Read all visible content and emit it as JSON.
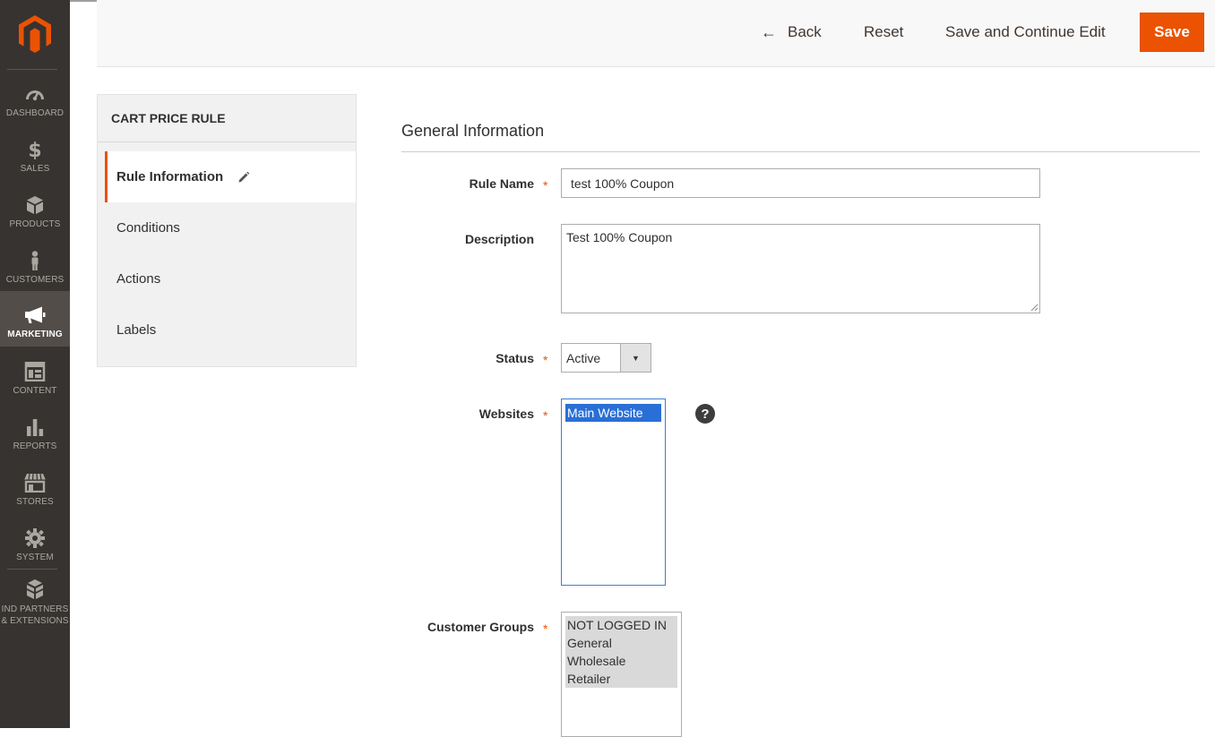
{
  "colors": {
    "accent": "#eb5202",
    "sidebar_bg": "#373330",
    "selection": "#2a6fd6"
  },
  "nav": {
    "items": [
      {
        "label": "DASHBOARD",
        "icon": "dashboard-icon"
      },
      {
        "label": "SALES",
        "icon": "dollar-icon"
      },
      {
        "label": "PRODUCTS",
        "icon": "cube-icon"
      },
      {
        "label": "CUSTOMERS",
        "icon": "person-icon"
      },
      {
        "label": "MARKETING",
        "icon": "megaphone-icon",
        "active": true
      },
      {
        "label": "CONTENT",
        "icon": "layout-icon"
      },
      {
        "label": "REPORTS",
        "icon": "bar-chart-icon"
      },
      {
        "label": "STORES",
        "icon": "storefront-icon"
      },
      {
        "label": "SYSTEM",
        "icon": "gear-icon"
      },
      {
        "label": "IND PARTNERS & EXTENSIONS",
        "icon": "boxes-icon"
      }
    ]
  },
  "header": {
    "back_label": "Back",
    "reset_label": "Reset",
    "save_continue_label": "Save and Continue Edit",
    "save_label": "Save"
  },
  "tabs": {
    "title": "CART PRICE RULE",
    "items": [
      {
        "label": "Rule Information",
        "active": true
      },
      {
        "label": "Conditions"
      },
      {
        "label": "Actions"
      },
      {
        "label": "Labels"
      }
    ]
  },
  "form": {
    "section_title": "General Information",
    "rule_name": {
      "label": "Rule Name",
      "value": "test 100% Coupon",
      "required": true
    },
    "description": {
      "label": "Description",
      "value": "Test 100% Coupon"
    },
    "status": {
      "label": "Status",
      "value": "Active",
      "required": true
    },
    "websites": {
      "label": "Websites",
      "options": [
        "Main Website"
      ],
      "required": true
    },
    "customer_groups": {
      "label": "Customer Groups",
      "options": [
        "NOT LOGGED IN",
        "General",
        "Wholesale",
        "Retailer"
      ],
      "required": true
    },
    "help_symbol": "?",
    "required_symbol": "*"
  }
}
